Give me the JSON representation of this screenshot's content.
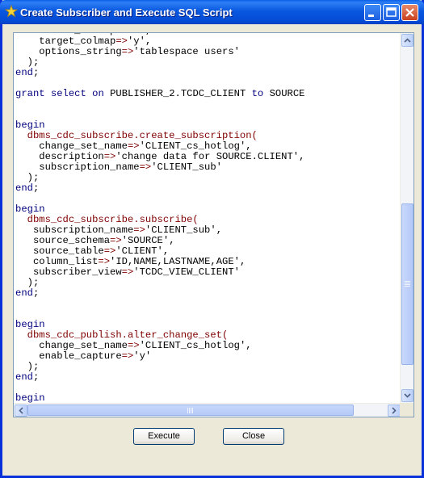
{
  "window": {
    "title": "Create Subscriber and Execute SQL Script"
  },
  "titlebar_buttons": {
    "minimize": "minimize-icon",
    "maximize": "maximize-icon",
    "close": "close-icon"
  },
  "editor": {
    "lines": [
      "    source_colmap=>'n',",
      "    target_colmap=>'y',",
      "    options_string=>'tablespace users'",
      "  );",
      "end;",
      "",
      "grant select on PUBLISHER_2.TCDC_CLIENT to SOURCE",
      "",
      "",
      "begin",
      "  dbms_cdc_subscribe.create_subscription(",
      "    change_set_name=>'CLIENT_cs_hotlog',",
      "    description=>'change data for SOURCE.CLIENT',",
      "    subscription_name=>'CLIENT_sub'",
      "  );",
      "end;",
      "",
      "begin",
      "  dbms_cdc_subscribe.subscribe(",
      "   subscription_name=>'CLIENT_sub',",
      "   source_schema=>'SOURCE',",
      "   source_table=>'CLIENT',",
      "   column_list=>'ID,NAME,LASTNAME,AGE',",
      "   subscriber_view=>'TCDC_VIEW_CLIENT'",
      "  );",
      "end;",
      "",
      "",
      "begin",
      "  dbms_cdc_publish.alter_change_set(",
      "    change_set_name=>'CLIENT_cs_hotlog',",
      "    enable_capture=>'y'",
      "  );",
      "end;",
      "",
      "begin"
    ]
  },
  "buttons": {
    "execute": "Execute",
    "close": "Close"
  },
  "colors": {
    "keyword": "#00007f",
    "function": "#7f0000",
    "titlebar": "#0a58e0"
  }
}
